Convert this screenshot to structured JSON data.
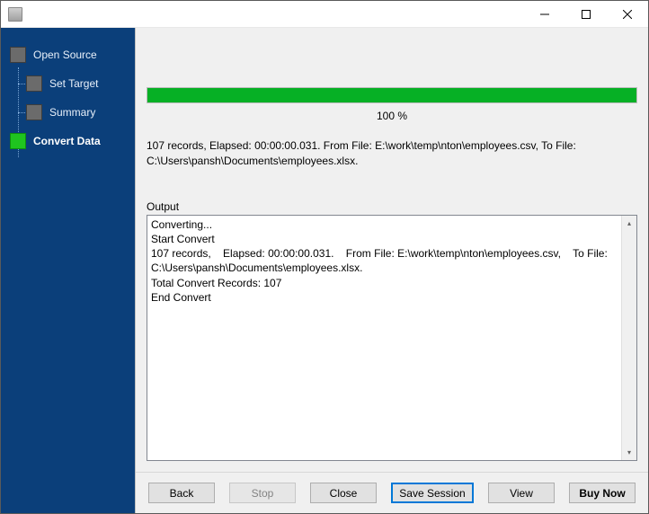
{
  "window": {
    "title": ""
  },
  "sidebar": {
    "items": [
      {
        "label": "Open Source",
        "active": false
      },
      {
        "label": "Set Target",
        "active": false
      },
      {
        "label": "Summary",
        "active": false
      },
      {
        "label": "Convert Data",
        "active": true
      }
    ]
  },
  "progress": {
    "percent": 100,
    "label": "100 %"
  },
  "status": {
    "text": "107 records,    Elapsed: 00:00:00.031.    From File: E:\\work\\temp\\nton\\employees.csv,    To File: C:\\Users\\pansh\\Documents\\employees.xlsx."
  },
  "output": {
    "label": "Output",
    "lines": [
      "Converting...",
      "Start Convert",
      "107 records,    Elapsed: 00:00:00.031.    From File: E:\\work\\temp\\nton\\employees.csv,    To File: C:\\Users\\pansh\\Documents\\employees.xlsx.",
      "Total Convert Records: 107",
      "End Convert"
    ]
  },
  "buttons": {
    "back": "Back",
    "stop": "Stop",
    "close": "Close",
    "save_session": "Save Session",
    "view": "View",
    "buy_now": "Buy Now"
  }
}
